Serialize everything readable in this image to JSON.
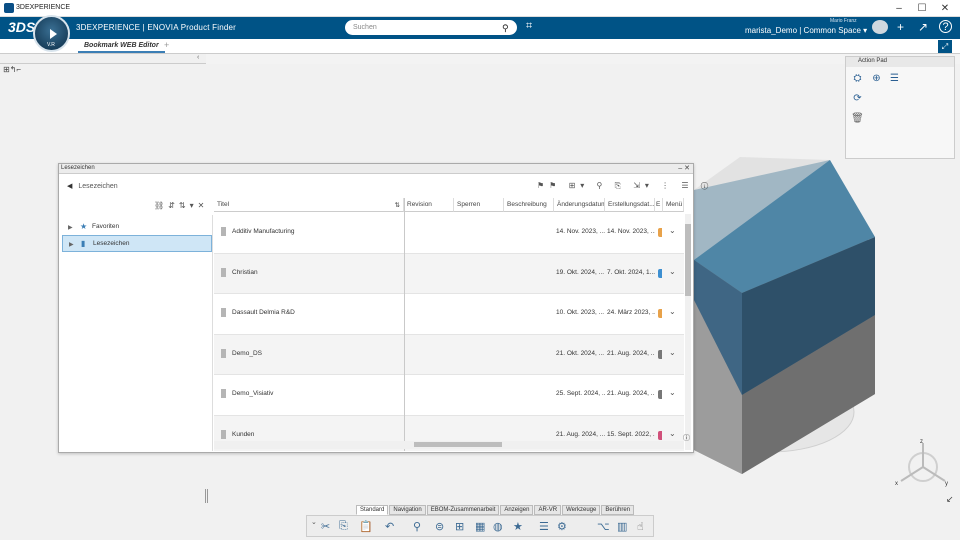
{
  "window": {
    "title": "3DEXPERIENCE",
    "controls": {
      "minimize": "–",
      "maximize": "☐",
      "close": "✕"
    }
  },
  "topbar": {
    "logo": "3DS",
    "compass_version": "V.R",
    "app_name": "3DEXPERIENCE | ENOVIA Product Finder",
    "search_placeholder": "Suchen",
    "user_name": "Mario Franz",
    "context": "marista_Demo | Common Space ▾"
  },
  "tabs": {
    "active": "Bookmark WEB Editor",
    "add": "+"
  },
  "action_pad": {
    "title": "Action Pad"
  },
  "dialog": {
    "title": "Lesezeichen",
    "breadcrumb": "Lesezeichen",
    "tree": [
      {
        "label": "Favoriten",
        "selected": false
      },
      {
        "label": "Lesezeichen",
        "selected": true
      }
    ],
    "columns": [
      "Titel",
      "Revision",
      "Sperren",
      "Beschreibung",
      "Änderungsdatum",
      "Erstellungsdat...",
      "E",
      "Menü"
    ],
    "rows": [
      {
        "title": "Additiv Manufacturing",
        "changed": "14. Nov. 2023, ...",
        "created": "14. Nov. 2023, ...",
        "dot": "#e8a24a"
      },
      {
        "title": "Christian",
        "changed": "19. Okt. 2024, ...",
        "created": "7. Okt. 2024, 1...",
        "dot": "#3d8fd1"
      },
      {
        "title": "Dassault Delmia R&D",
        "changed": "10. Okt. 2023, ...",
        "created": "24. März 2023, ...",
        "dot": "#e8a24a"
      },
      {
        "title": "Demo_DS",
        "changed": "21. Okt. 2024, ...",
        "created": "21. Aug. 2024, ...",
        "dot": "#777777"
      },
      {
        "title": "Demo_Visiativ",
        "changed": "25. Sept. 2024, ...",
        "created": "21. Aug. 2024, ...",
        "dot": "#777777"
      },
      {
        "title": "Kunden",
        "changed": "21. Aug. 2024, ...",
        "created": "15. Sept. 2022, ...",
        "dot": "#d0507a"
      }
    ]
  },
  "bottom_tabs": [
    "Standard",
    "Navigation",
    "EBOM-Zusammenarbeit",
    "Anzeigen",
    "AR-VR",
    "Werkzeuge",
    "Berühren"
  ],
  "axis": {
    "x": "x",
    "y": "y",
    "z": "z"
  },
  "colors": {
    "brand": "#005386",
    "selection": "#cfe6f6",
    "cube_top": "#4f86a6",
    "cube_front": "#2e5069",
    "cube_base": "#7a7a7a"
  }
}
